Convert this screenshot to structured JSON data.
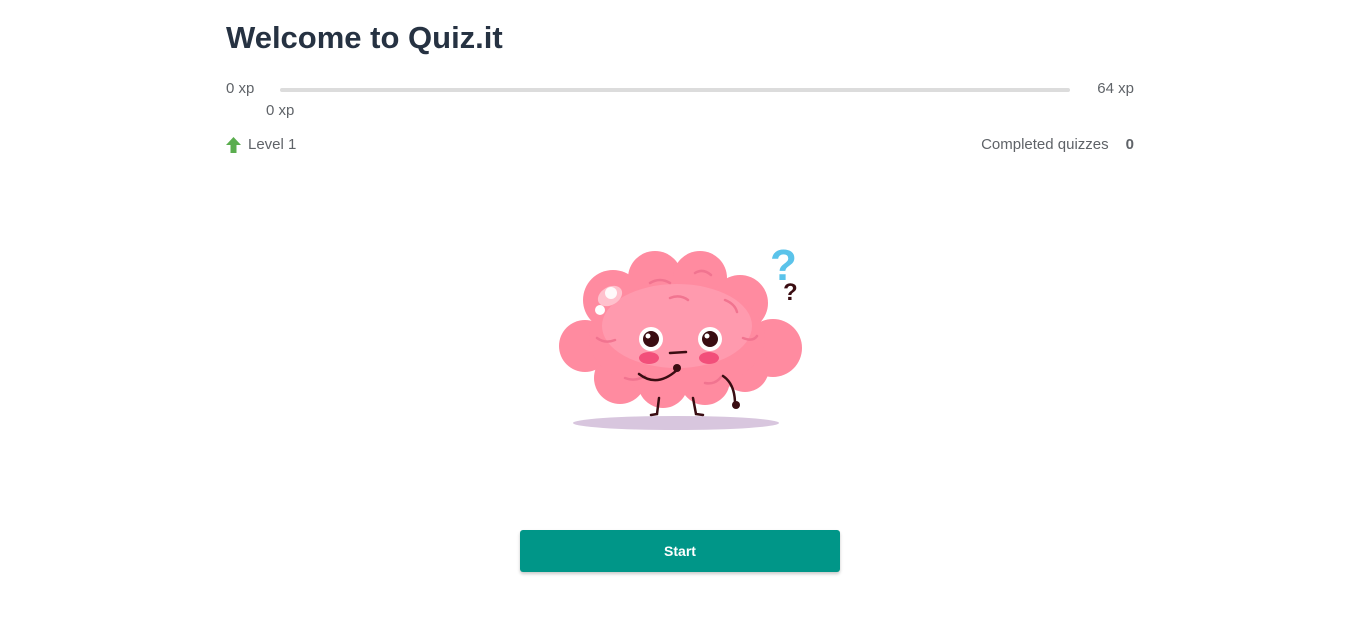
{
  "header": {
    "title": "Welcome to Quiz.it"
  },
  "progress": {
    "min_label": "0 xp",
    "max_label": "64 xp",
    "current_label": "0 xp",
    "fraction": 0,
    "fill_color": "#009688",
    "track_color": "#dcdcdc"
  },
  "stats": {
    "level_label": "Level 1",
    "level_icon": "arrow-up-icon",
    "level_icon_color": "#5aad4e",
    "completed_label": "Completed quizzes",
    "completed_count": "0"
  },
  "mascot": {
    "icon": "brain-mascot-icon"
  },
  "actions": {
    "start_label": "Start",
    "start_color": "#009688"
  }
}
